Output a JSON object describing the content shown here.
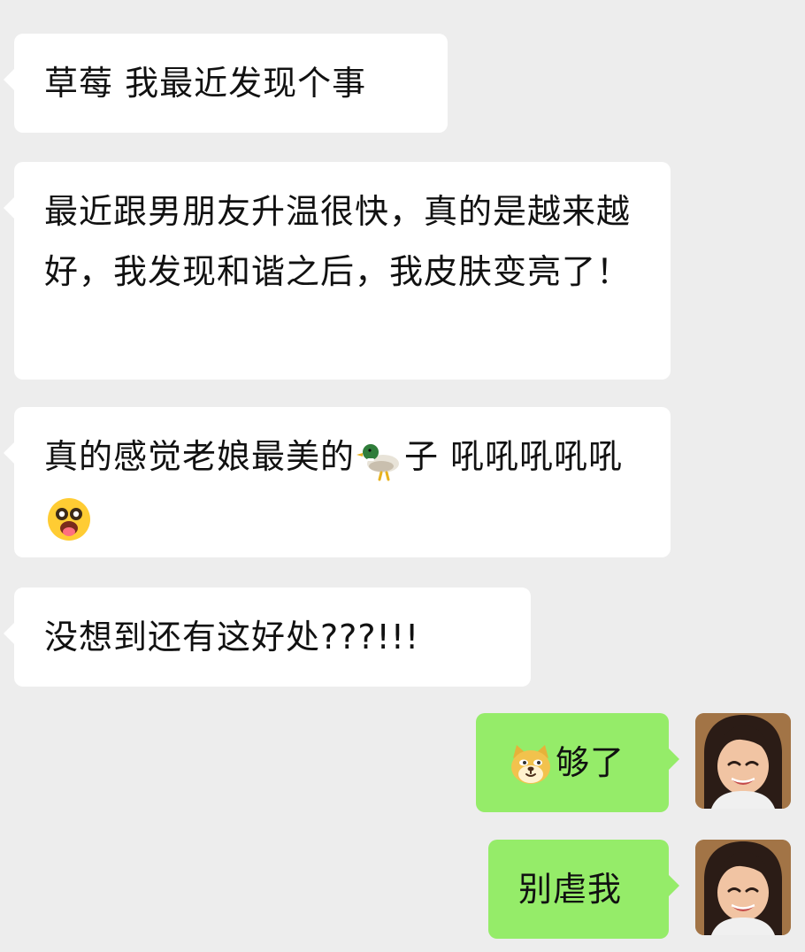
{
  "chat": {
    "messages": [
      {
        "from": "other",
        "text": "草莓 我最近发现个事"
      },
      {
        "from": "other",
        "text": "最近跟男朋友升温很快，真的是越来越好，我发现和谐之后，我皮肤变亮了！"
      },
      {
        "from": "other",
        "part1": "真的感觉老娘最美的",
        "emoji1": "duck-emoji",
        "part2": "子 吼吼吼吼吼",
        "emoji2": "surprised-tongue-emoji"
      },
      {
        "from": "other",
        "text": "没想到还有这好处???!!!"
      },
      {
        "from": "me",
        "emoji": "doge-emoji",
        "text": "够了"
      },
      {
        "from": "me",
        "text": "别虐我"
      }
    ]
  },
  "colors": {
    "background": "#ededed",
    "incoming_bubble": "#ffffff",
    "outgoing_bubble": "#95ec69"
  },
  "avatars": {
    "me": "smiling-girl-avatar"
  }
}
